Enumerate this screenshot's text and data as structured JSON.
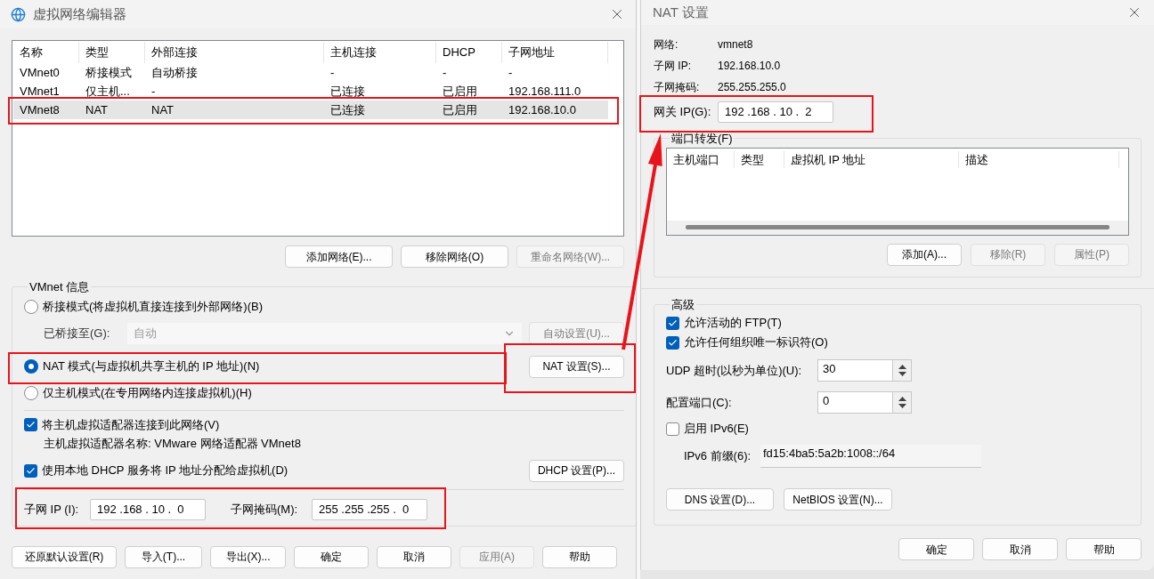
{
  "network_editor": {
    "title": "虚拟网络编辑器",
    "columns": [
      "名称",
      "类型",
      "外部连接",
      "主机连接",
      "DHCP",
      "子网地址"
    ],
    "rows": [
      {
        "cells": [
          "VMnet0",
          "桥接模式",
          "自动桥接",
          "-",
          "-",
          "-"
        ],
        "selected": false
      },
      {
        "cells": [
          "VMnet1",
          "仅主机...",
          "-",
          "已连接",
          "已启用",
          "192.168.111.0"
        ],
        "selected": false
      },
      {
        "cells": [
          "VMnet8",
          "NAT",
          "NAT",
          "已连接",
          "已启用",
          "192.168.10.0"
        ],
        "selected": true
      }
    ],
    "list_buttons": [
      {
        "label": "添加网络(E)...",
        "disabled": false
      },
      {
        "label": "移除网络(O)",
        "disabled": false
      },
      {
        "label": "重命名网络(W)...",
        "disabled": true
      }
    ],
    "info": {
      "title": "VMnet 信息",
      "modes": [
        {
          "label": "桥接模式(将虚拟机直接连接到外部网络)(B)",
          "selected": false
        },
        {
          "label": "NAT 模式(与虚拟机共享主机的 IP 地址)(N)",
          "selected": true
        },
        {
          "label": "仅主机模式(在专用网络内连接虚拟机)(H)",
          "selected": false
        }
      ],
      "bridged_to": {
        "label": "已桥接至(G):",
        "value": "自动",
        "disabled": true
      },
      "auto_button": {
        "label": "自动设置(U)...",
        "disabled": true
      },
      "nat_button": {
        "label": "NAT 设置(S)...",
        "disabled": false
      },
      "adapter_checkbox": {
        "label": "将主机虚拟适配器连接到此网络(V)",
        "checked": true
      },
      "adapter_name": "主机虚拟适配器名称: VMware 网络适配器 VMnet8",
      "dhcp_checkbox": {
        "label": "使用本地 DHCP 服务将 IP 地址分配给虚拟机(D)",
        "checked": true
      },
      "dhcp_button": {
        "label": "DHCP 设置(P)...",
        "disabled": false
      },
      "subnet_ip": {
        "label": "子网 IP (I):",
        "value": "192 .168 . 10 .  0"
      },
      "subnet_mask": {
        "label": "子网掩码(M):",
        "value": "255 .255 .255 .  0"
      }
    },
    "footer_buttons": [
      {
        "label": "还原默认设置(R)",
        "disabled": false
      },
      {
        "label": "导入(T)...",
        "disabled": false
      },
      {
        "label": "导出(X)...",
        "disabled": false
      },
      {
        "label": "确定",
        "disabled": false
      },
      {
        "label": "取消",
        "disabled": false
      },
      {
        "label": "应用(A)",
        "disabled": true
      },
      {
        "label": "帮助",
        "disabled": false
      }
    ]
  },
  "nat_settings": {
    "title": "NAT 设置",
    "info": [
      {
        "label": "网络:",
        "value": "vmnet8"
      },
      {
        "label": "子网 IP:",
        "value": "192.168.10.0"
      },
      {
        "label": "子网掩码:",
        "value": "255.255.255.0"
      }
    ],
    "gateway": {
      "label": "网关 IP(G):",
      "value": "192 .168 . 10 .  2"
    },
    "port_forwarding": {
      "title": "端口转发(F)",
      "columns": [
        "主机端口",
        "类型",
        "虚拟机 IP 地址",
        "描述"
      ],
      "buttons": [
        {
          "label": "添加(A)...",
          "disabled": false
        },
        {
          "label": "移除(R)",
          "disabled": true
        },
        {
          "label": "属性(P)",
          "disabled": true
        }
      ]
    },
    "advanced": {
      "title": "高级",
      "checkboxes": [
        {
          "label": "允许活动的 FTP(T)",
          "checked": true
        },
        {
          "label": "允许任何组织唯一标识符(O)",
          "checked": true
        }
      ],
      "udp_timeout": {
        "label": "UDP 超时(以秒为单位)(U):",
        "value": "30"
      },
      "config_port": {
        "label": "配置端口(C):",
        "value": "0"
      },
      "ipv6": {
        "label": "启用 IPv6(E)",
        "checked": false
      },
      "ipv6_prefix": {
        "label": "IPv6 前缀(6):",
        "value": "fd15:4ba5:5a2b:1008::/64"
      },
      "buttons": [
        {
          "label": "DNS 设置(D)...",
          "disabled": false
        },
        {
          "label": "NetBIOS 设置(N)...",
          "disabled": false
        }
      ]
    },
    "footer_buttons": [
      {
        "label": "确定",
        "disabled": false
      },
      {
        "label": "取消",
        "disabled": false
      },
      {
        "label": "帮助",
        "disabled": false
      }
    ]
  }
}
